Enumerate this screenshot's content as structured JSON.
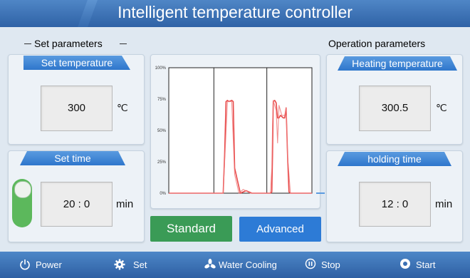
{
  "header": {
    "title": "Intelligent temperature controller"
  },
  "left": {
    "section_title": "Set parameters",
    "set_temperature": {
      "label": "Set temperature",
      "value": "300",
      "unit": "℃"
    },
    "set_time": {
      "label": "Set time",
      "value": "20 : 0",
      "unit": "min"
    }
  },
  "right": {
    "section_title": "Operation parameters",
    "heating_temperature": {
      "label": "Heating temperature",
      "value": "300.5",
      "unit": "℃"
    },
    "holding_time": {
      "label": "holding time",
      "value": "12 : 0",
      "unit": "min"
    }
  },
  "buttons": {
    "standard": "Standard",
    "advanced": "Advanced"
  },
  "footer": {
    "power": "Power",
    "set": "Set",
    "water_cooling": "Water Cooling",
    "stop": "Stop",
    "start": "Start"
  },
  "colors": {
    "header": "#3a70b4",
    "tab": "#2e76cc",
    "standard": "#3a9b56",
    "advanced": "#2d7bd6",
    "trace": "#e84a4a"
  },
  "chart_data": {
    "type": "line",
    "y_tick_labels": [
      "100%",
      "75%",
      "50%",
      "25%",
      "0%"
    ],
    "ylim": [
      0,
      100
    ],
    "xlim": [
      0,
      100
    ],
    "grid": false,
    "markers_x": [
      31.5,
      68.5
    ],
    "series": [
      {
        "x": [
          0,
          28,
          30,
          32,
          36,
          38,
          39,
          40,
          41,
          42,
          44,
          45,
          46,
          50,
          54,
          58,
          63,
          66,
          69,
          70,
          71,
          72,
          72.5,
          73,
          74,
          75,
          76,
          77,
          78,
          80,
          81,
          82,
          83,
          84,
          85,
          86,
          90,
          100
        ],
        "y": [
          0,
          0,
          0,
          0,
          0,
          0,
          30,
          73,
          74,
          73,
          74,
          73,
          20,
          0,
          2,
          0,
          0,
          0,
          0,
          0,
          0,
          1,
          30,
          73,
          74,
          72,
          60,
          60,
          62,
          60,
          60,
          68,
          30,
          1,
          0,
          0,
          0,
          0
        ]
      },
      {
        "x": [
          0,
          28,
          35,
          38,
          41,
          44,
          46,
          49,
          52,
          57,
          63,
          67,
          71,
          72,
          72.5,
          73,
          75,
          76,
          77,
          79,
          81,
          82,
          83,
          85,
          90,
          100
        ],
        "y": [
          0,
          0,
          0,
          0,
          73,
          73,
          15,
          0,
          3,
          0,
          0,
          0,
          0,
          20,
          55,
          74,
          66,
          40,
          70,
          62,
          62,
          68,
          30,
          0,
          0,
          0
        ]
      }
    ]
  }
}
